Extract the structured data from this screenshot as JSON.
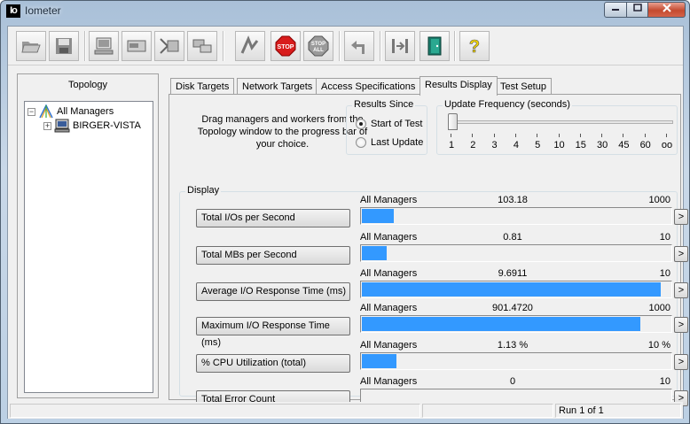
{
  "window": {
    "title": "Iometer",
    "app_icon_text": "Io",
    "colors": {
      "close": "#c44a2f"
    }
  },
  "toolbar": {
    "buttons": [
      {
        "icon": "open-folder-icon"
      },
      {
        "icon": "save-icon"
      },
      {
        "icon": "new-disk-worker-icon"
      },
      {
        "icon": "new-network-worker-icon"
      },
      {
        "icon": "duplicate-worker-icon"
      },
      {
        "icon": "disconnect-icon"
      },
      {
        "icon": "start-tests-icon"
      },
      {
        "icon": "stop-icon",
        "label": "STOP"
      },
      {
        "icon": "stop-all-icon",
        "label": "STOP",
        "label2": "ALL"
      },
      {
        "icon": "reset-workers-icon"
      },
      {
        "icon": "exit-icon"
      },
      {
        "icon": "exit-door-icon"
      },
      {
        "icon": "help-icon",
        "label": "?"
      }
    ]
  },
  "topology": {
    "title": "Topology",
    "items": [
      {
        "label": "All Managers",
        "expander": "−"
      },
      {
        "label": "BIRGER-VISTA",
        "expander": "+"
      }
    ]
  },
  "tabs": [
    {
      "label": "Disk Targets"
    },
    {
      "label": "Network Targets"
    },
    {
      "label": "Access Specifications"
    },
    {
      "label": "Results Display",
      "active": true
    },
    {
      "label": "Test Setup"
    }
  ],
  "results": {
    "drag_text": "Drag managers and workers from the Topology window to the progress bar of your choice.",
    "results_since": {
      "legend": "Results Since",
      "options": [
        {
          "label": "Start of Test",
          "selected": true
        },
        {
          "label": "Last Update",
          "selected": false
        }
      ]
    },
    "update_frequency": {
      "legend": "Update Frequency (seconds)",
      "ticks": [
        "1",
        "2",
        "3",
        "4",
        "5",
        "10",
        "15",
        "30",
        "45",
        "60",
        "oo"
      ],
      "selected": "1"
    },
    "display_legend": "Display",
    "bar_color": "#3399ff",
    "metrics": [
      {
        "label": "Total I/Os per Second",
        "manager": "All Managers",
        "value": "103.18",
        "max": "1000",
        "fraction": 0.1032
      },
      {
        "label": "Total MBs per Second",
        "manager": "All Managers",
        "value": "0.81",
        "max": "10",
        "fraction": 0.081
      },
      {
        "label": "Average I/O Response Time (ms)",
        "manager": "All Managers",
        "value": "9.6911",
        "max": "10",
        "fraction": 0.9691
      },
      {
        "label": "Maximum I/O Response Time (ms)",
        "manager": "All Managers",
        "value": "901.4720",
        "max": "1000",
        "fraction": 0.9015
      },
      {
        "label": "% CPU Utilization (total)",
        "manager": "All Managers",
        "value": "1.13 %",
        "max": "10 %",
        "fraction": 0.113
      },
      {
        "label": "Total Error Count",
        "manager": "All Managers",
        "value": "0",
        "max": "10",
        "fraction": 0
      }
    ],
    "chevron": ">"
  },
  "statusbar": {
    "run": "Run 1 of 1"
  }
}
